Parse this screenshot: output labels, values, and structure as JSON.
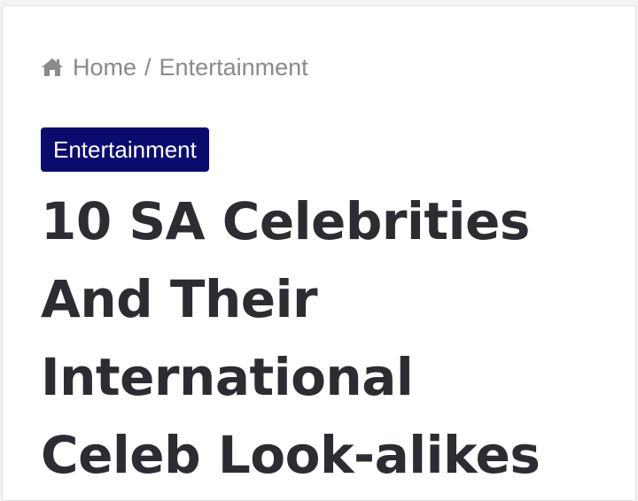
{
  "breadcrumb": {
    "home_icon": "home-icon",
    "home_label": "Home",
    "separator": "/",
    "current_label": "Entertainment"
  },
  "article": {
    "category": "Entertainment",
    "title_lines": [
      "10 SA Celebrities",
      "And Their",
      "International",
      "Celeb Look-alikes"
    ]
  },
  "colors": {
    "badge_bg": "#0b0b6e",
    "title_text": "#2b2d33",
    "breadcrumb_text": "#8a8a8a"
  }
}
